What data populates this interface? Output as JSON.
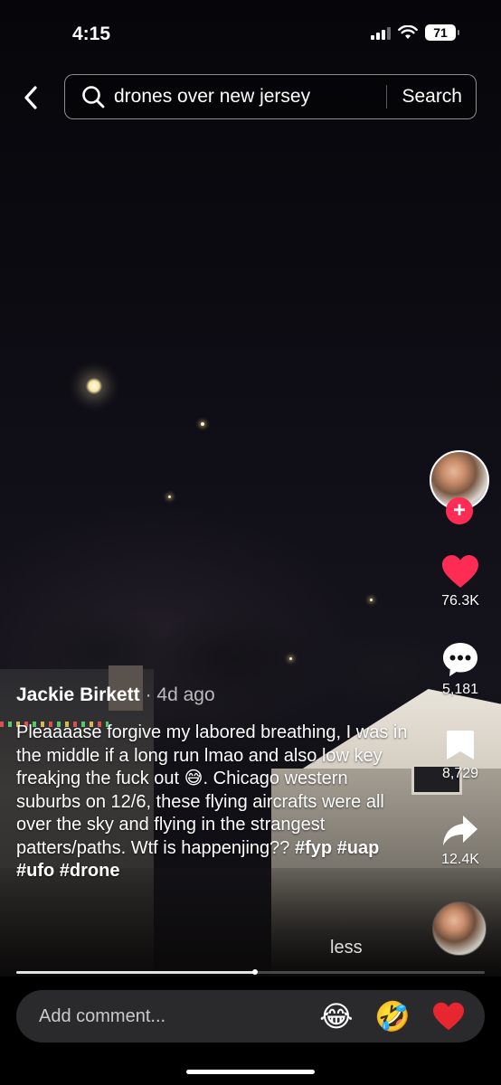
{
  "status_bar": {
    "time": "4:15",
    "battery": "71"
  },
  "search": {
    "query": "drones over new jersey",
    "button_label": "Search"
  },
  "creator": {
    "name": "Jackie Birkett",
    "posted": "· 4d ago"
  },
  "caption": {
    "text": "Pleaaaase forgive my labored breathing, I was in the middle if a long run lmao and also low key freakjng the fuck out 😅. Chicago western suburbs on 12/6, these flying aircrafts were all over the sky and flying in the strangest patters/paths. Wtf is happenjing?? ",
    "hashtags": [
      "#fyp",
      "#uap",
      "#ufo",
      "#drone"
    ],
    "toggle": "less"
  },
  "actions": {
    "likes": "76.3K",
    "comments": "5,181",
    "saves": "8,729",
    "shares": "12.4K"
  },
  "follow": {
    "symbol": "+"
  },
  "playback": {
    "progress_fraction": 0.51
  },
  "comment_bar": {
    "placeholder": "Add comment...",
    "emojis": [
      "😂",
      "🤣",
      "❤️"
    ]
  },
  "colors": {
    "accent": "#fe2c55",
    "heart": "#fe2c55"
  },
  "icons": [
    "back-chevron-icon",
    "search-icon",
    "heart-icon",
    "comment-bubble-icon",
    "bookmark-icon",
    "share-arrow-icon"
  ]
}
